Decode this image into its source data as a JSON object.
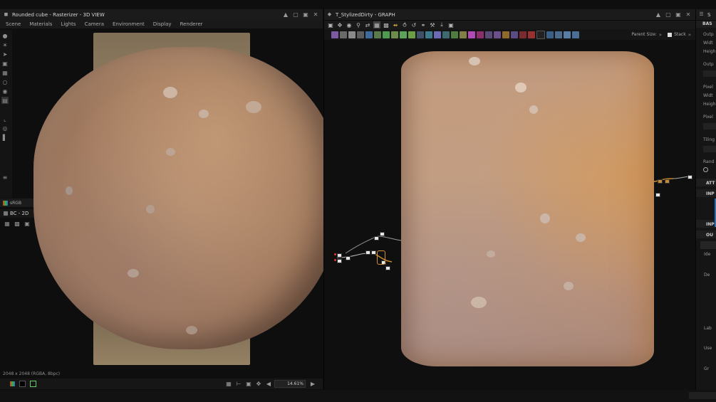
{
  "viewport3d": {
    "title": "Rounded cube - Rasterizer - 3D VIEW",
    "menu": [
      "Scene",
      "Materials",
      "Lights",
      "Camera",
      "Environment",
      "Display",
      "Renderer"
    ]
  },
  "view2d": {
    "tab_label": "sRGB",
    "title": "BC - 2D",
    "status": "2048 x 2048 (RGBA, 8bpc)",
    "zoom": "14.61%"
  },
  "graph": {
    "title": "T_StylizedDirty - GRAPH",
    "parent_size_label": "Parent Size:",
    "stack_label": "Stack"
  },
  "properties": {
    "title": "S",
    "rows": [
      "BAS",
      "Outp",
      "Widt",
      "Heigh",
      "Outp",
      "Pixel",
      "Widt",
      "Heigh",
      "Pixel",
      "Tiling",
      "Rand",
      "ATT",
      "INP",
      "INP",
      "OU",
      "Ide",
      "De",
      "Lab",
      "Use",
      "Gr"
    ]
  },
  "colors": {
    "panel_bg": "#0e0e0f",
    "titlebar_bg": "#1b1b1c",
    "stone_light": "#c9a283",
    "stone_dark": "#7a5a47",
    "accent_orange": "#d4903a"
  }
}
